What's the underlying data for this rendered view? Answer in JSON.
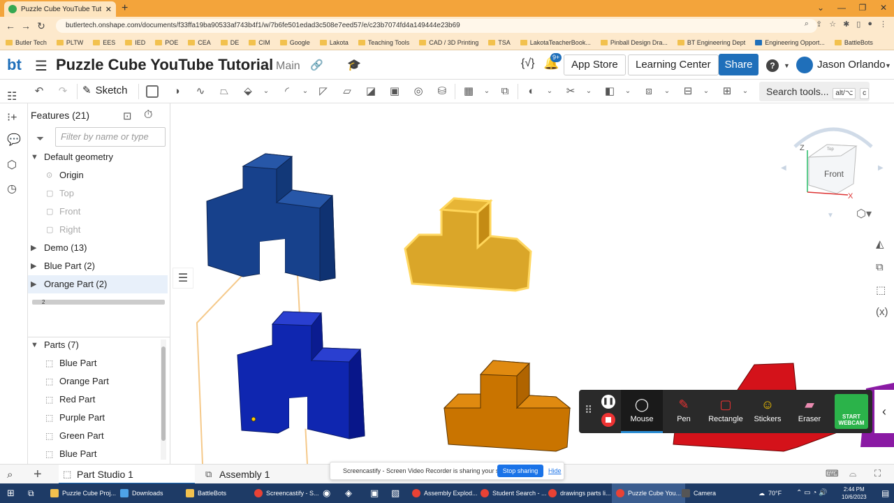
{
  "browser": {
    "tab_title": "Puzzle Cube YouTube Tutorial | ",
    "url": "butlertech.onshape.com/documents/f33ffa19ba90533af743b4f1/w/7b6fe501edad3c508e7eed57/e/c23b7074fd4a149444e23b69",
    "bookmarks": [
      "Butler Tech",
      "PLTW",
      "EES",
      "IED",
      "POE",
      "CEA",
      "DE",
      "CIM",
      "Google",
      "Lakota",
      "Teaching Tools",
      "CAD / 3D Printing",
      "TSA",
      "LakotaTeacherBook...",
      "Pinball Design Dra...",
      "BT Engineering Dept",
      "Engineering Opport...",
      "BattleBots"
    ]
  },
  "header": {
    "logo": "bt",
    "doc_title": "Puzzle Cube YouTube Tutorial",
    "branch": "Main",
    "notif_badge": "9+",
    "app_store": "App Store",
    "learning_center": "Learning Center",
    "share": "Share",
    "help": "?",
    "user": "Jason Orlando"
  },
  "toolbar": {
    "sketch": "Sketch",
    "search": "Search tools...",
    "search_kbd": "alt/⌥",
    "search_key": "c"
  },
  "features": {
    "title": "Features (21)",
    "filter_placeholder": "Filter by name or type",
    "default_geometry": "Default geometry",
    "origin": "Origin",
    "top": "Top",
    "front": "Front",
    "right": "Right",
    "demo": "Demo (13)",
    "blue_part_feat": "Blue Part (2)",
    "orange_part_feat": "Orange Part (2)",
    "rollback_num": "2"
  },
  "parts": {
    "title": "Parts (7)",
    "items": [
      "Blue Part",
      "Orange Part",
      "Red Part",
      "Purple Part",
      "Green Part",
      "Blue Part"
    ]
  },
  "viewcube": {
    "face": "Front",
    "z": "Z",
    "x": "X",
    "top": "Top"
  },
  "screencastify": {
    "mouse": "Mouse",
    "pen": "Pen",
    "rectangle": "Rectangle",
    "stickers": "Stickers",
    "eraser": "Eraser",
    "webcam": "START WEBCAM"
  },
  "bottom": {
    "tab1": "Part Studio 1",
    "tab2": "Assembly 1",
    "share_msg": "Screencastify - Screen Video Recorder is sharing your screen.",
    "stop_sharing": "Stop sharing",
    "hide": "Hide"
  },
  "taskbar": {
    "items": [
      "Puzzle Cube Proj...",
      "Downloads",
      "BattleBots",
      "Screencastify - S...",
      "Assembly Explod...",
      "Student Search - ...",
      "drawings parts li...",
      "Puzzle Cube You...",
      "Camera"
    ],
    "weather": "70°F",
    "time": "2:44 PM",
    "date": "10/6/2023"
  },
  "colors": {
    "accent": "#1f6fba",
    "chrome": "#f3a43b",
    "blue_part": "#1c4fa0",
    "orange_part": "#e8a51a",
    "red_part": "#d8121a"
  }
}
